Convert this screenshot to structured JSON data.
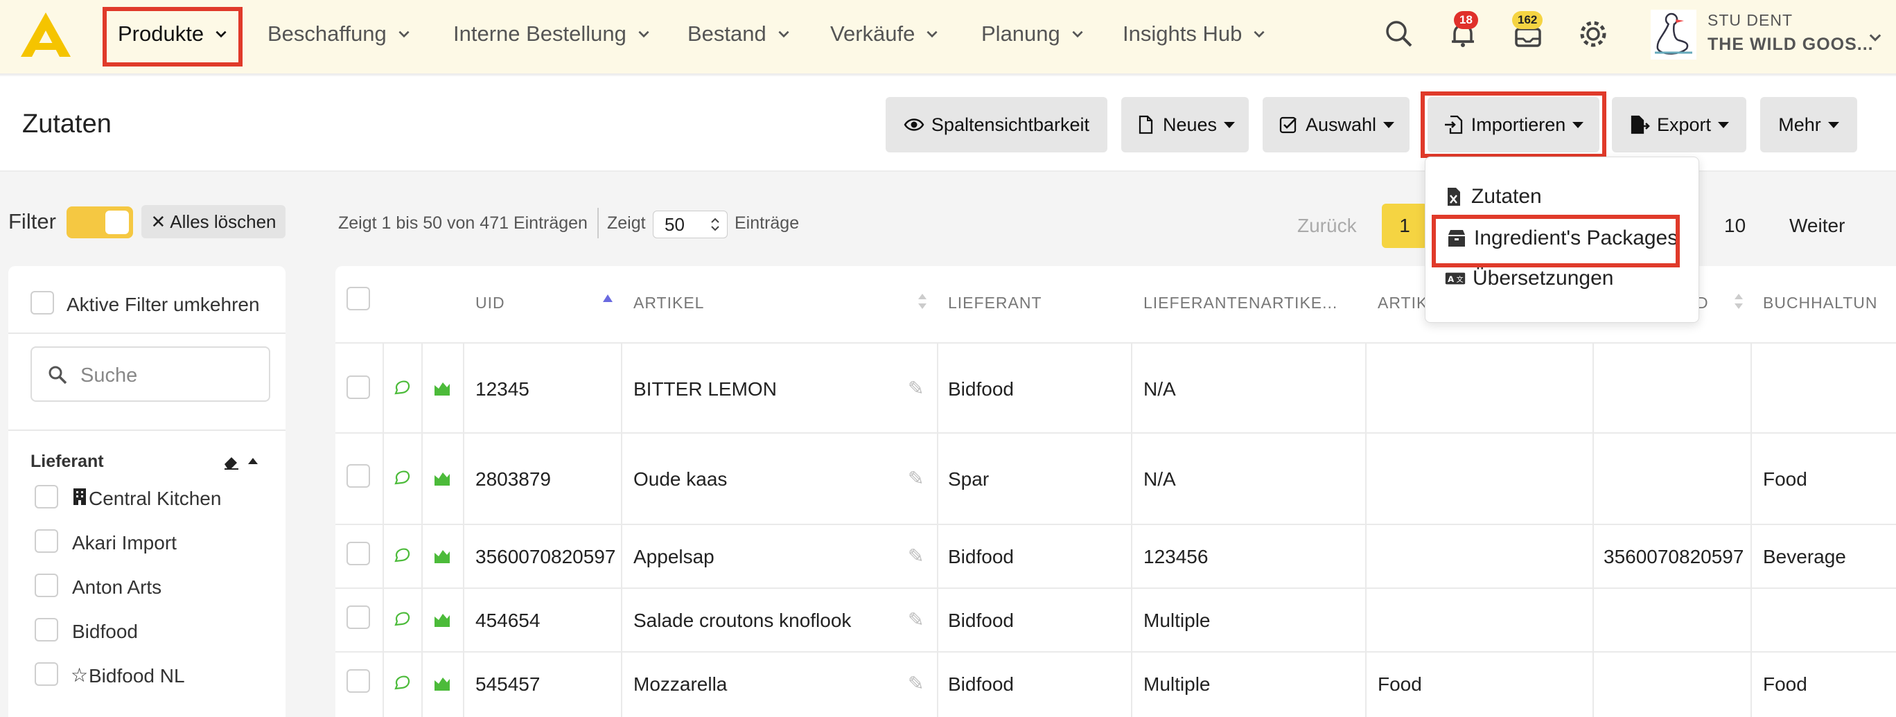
{
  "nav": {
    "items": [
      "Produkte",
      "Beschaffung",
      "Interne Bestellung",
      "Bestand",
      "Verkäufe",
      "Planung",
      "Insights Hub"
    ],
    "notifications_count": "18",
    "messages_count": "162",
    "user_role": "STU DENT",
    "user_company": "THE WILD GOOS..."
  },
  "page": {
    "title": "Zutaten",
    "buttons": {
      "columns": "Spaltensichtbarkeit",
      "new": "Neues",
      "selection": "Auswahl",
      "import": "Importieren",
      "export": "Export",
      "more": "Mehr"
    }
  },
  "import_menu": {
    "items": [
      "Zutaten",
      "Ingredient's Packages",
      "Übersetzungen"
    ]
  },
  "filterbar": {
    "label": "Filter",
    "clear_all": "Alles löschen",
    "showing": "Zeigt 1 bis 50 von 471 Einträgen",
    "show": "Zeigt",
    "page_size": "50",
    "entries": "Einträge",
    "prev": "Zurück",
    "current_page": "1",
    "last_page": "10",
    "next": "Weiter"
  },
  "sidebar": {
    "invert": "Aktive Filter umkehren",
    "search_placeholder": "Suche",
    "section_title": "Lieferant",
    "suppliers": [
      "Central Kitchen",
      "Akari Import",
      "Anton Arts",
      "Bidfood",
      "Bidfood NL"
    ]
  },
  "table": {
    "headers": [
      "UID",
      "ARTIKEL",
      "LIEFERANT",
      "LIEFERANTENARTIKE...",
      "ARTIK",
      "D",
      "BUCHHALTUN"
    ],
    "rows": [
      [
        "12345",
        "BITTER LEMON",
        "Bidfood",
        "N/A",
        "",
        "",
        ""
      ],
      [
        "2803879",
        "Oude kaas",
        "Spar",
        "N/A",
        "",
        "",
        "Food"
      ],
      [
        "3560070820597",
        "Appelsap",
        "Bidfood",
        "123456",
        "",
        "3560070820597",
        "Beverage"
      ],
      [
        "454654",
        "Salade croutons knoflook",
        "Bidfood",
        "Multiple",
        "",
        "",
        ""
      ],
      [
        "545457",
        "Mozzarella",
        "Bidfood",
        "Multiple",
        "Food",
        "",
        "Food"
      ]
    ]
  },
  "colors": {
    "accent": "#f5c842",
    "highlight": "#e03a2a",
    "nav_bg": "#fdf9e6"
  }
}
